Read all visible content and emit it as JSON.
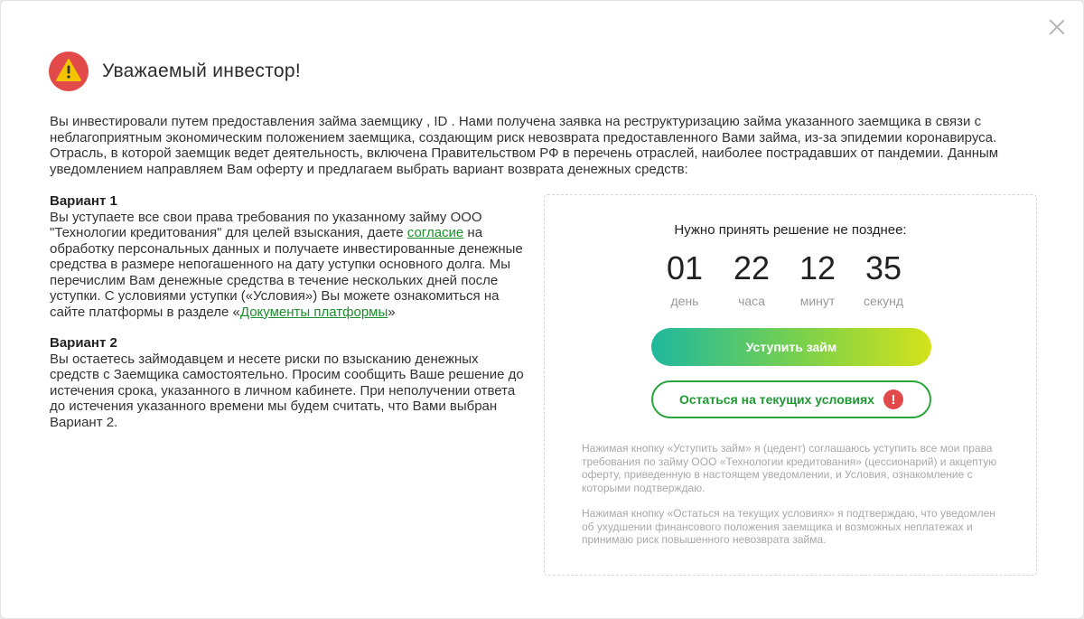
{
  "header": {
    "title": "Уважаемый инвестор!",
    "icon": "warning-icon"
  },
  "intro": "Вы инвестировали путем предоставления займа заемщику , ID . Нами получена заявка на реструктуризацию займа указанного заемщика в связи с неблагоприятным экономическим положением заемщика, создающим риск невозврата предоставленного Вами займа, из-за эпидемии коронавируса. Отрасль, в которой заемщик ведет деятельность, включена Правительством РФ в перечень отраслей, наиболее пострадавших от пандемии. Данным уведомлением направляем Вам оферту и предлагаем выбрать вариант возврата денежных средств:",
  "option1": {
    "title": "Вариант 1",
    "text_before_link": "Вы уступаете все свои права требования по указанному займу ООО \"Технологии кредитования\" для целей взыскания, даете ",
    "consent_link": "согласие",
    "text_after_link": " на обработку персональных данных и получаете инвестированные денежные средства в размере непогашенного на дату уступки основного долга. Мы перечислим Вам денежные средства в течение нескольких дней после уступки. С условиями уступки («Условия») Вы можете ознакомиться на сайте платформы в разделе «",
    "docs_link": "Документы платформы",
    "text_end": "»"
  },
  "option2": {
    "title": "Вариант 2",
    "text": "Вы остаетесь займодавцем и несете риски по взысканию денежных средств с Заемщика самостоятельно. Просим сообщить Ваше решение до истечения срока, указанного в личном кабинете. При неполучении ответа до истечения указанного времени мы будем считать, что Вами выбран Вариант 2."
  },
  "panel": {
    "deadline_label": "Нужно принять решение не позднее:",
    "countdown": [
      {
        "value": "01",
        "unit": "день"
      },
      {
        "value": "22",
        "unit": "часа"
      },
      {
        "value": "12",
        "unit": "минут"
      },
      {
        "value": "35",
        "unit": "секунд"
      }
    ],
    "assign_button": "Уступить займ",
    "stay_button": "Остаться на текущих условиях",
    "stay_icon": "!",
    "note1": "Нажимая кнопку «Уступить займ» я (цедент) соглашаюсь уступить все мои права требования по займу ООО «Технологии кредитования» (цессионарий) и акцептую оферту, приведенную в настоящем уведомлении, и Условия, ознакомление с которыми подтверждаю.",
    "note2": "Нажимая кнопку «Остаться на текущих условиях» я подтверждаю, что уведомлен об ухудшении финансового положения заемщика и возможных неплатежах и принимаю риск повышенного невозврата займа."
  },
  "colors": {
    "accent_green": "#2aa53b",
    "warning_red": "#e24a4a",
    "warning_yellow": "#f5c400"
  }
}
